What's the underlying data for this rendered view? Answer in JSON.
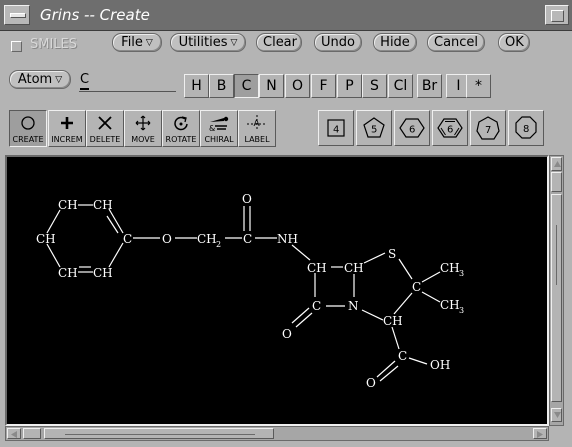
{
  "window": {
    "title": "Grins -- Create"
  },
  "toolbar": {
    "smiles_label": "SMILES",
    "file_label": "File",
    "utilities_label": "Utilities",
    "clear_label": "Clear",
    "undo_label": "Undo",
    "hide_label": "Hide",
    "cancel_label": "Cancel",
    "ok_label": "OK"
  },
  "atom": {
    "menu_label": "Atom",
    "current_value": "C",
    "elements": [
      "H",
      "B",
      "C",
      "N",
      "O",
      "F",
      "P",
      "S",
      "Cl",
      "Br",
      "I",
      "*"
    ],
    "selected_element": "C"
  },
  "tools": [
    {
      "label": "CREATE",
      "icon": "circle-icon"
    },
    {
      "label": "INCREM",
      "icon": "plus-icon"
    },
    {
      "label": "DELETE",
      "icon": "x-icon"
    },
    {
      "label": "MOVE",
      "icon": "move-arrows-icon"
    },
    {
      "label": "ROTATE",
      "icon": "rotate-icon"
    },
    {
      "label": "CHIRAL",
      "icon": "chiral-icon"
    },
    {
      "label": "LABEL",
      "icon": "label-icon"
    }
  ],
  "rings": [
    {
      "label": "4",
      "icon": "square-ring-icon"
    },
    {
      "label": "5",
      "icon": "pentagon-ring-icon"
    },
    {
      "label": "6",
      "icon": "hexagon-ring-icon"
    },
    {
      "label": "6",
      "icon": "benzene-ring-icon"
    },
    {
      "label": "7",
      "icon": "heptagon-ring-icon"
    },
    {
      "label": "8",
      "icon": "octagon-ring-icon"
    }
  ],
  "molecule": {
    "atom_labels": {
      "a1": "CH",
      "a2": "CH",
      "a3": "CH",
      "a4": "CH",
      "a5": "CH",
      "a6": "C",
      "o1": "O",
      "ch2": "CH",
      "ch2_sub": "2",
      "o2": "O",
      "c1": "C",
      "nh": "NH",
      "ch_a": "CH",
      "ch_b": "CH",
      "s": "S",
      "c2": "C",
      "me1": "CH",
      "me1_sub": "3",
      "me2": "CH",
      "me2_sub": "3",
      "c3": "C",
      "n": "N",
      "ch_c": "CH",
      "o3": "O",
      "c4": "C",
      "o4": "O",
      "oh": "OH"
    }
  },
  "colors": {
    "window_bg": "#b4b4b4",
    "canvas_bg": "#000000",
    "titlebar": "#6e6e6e"
  }
}
